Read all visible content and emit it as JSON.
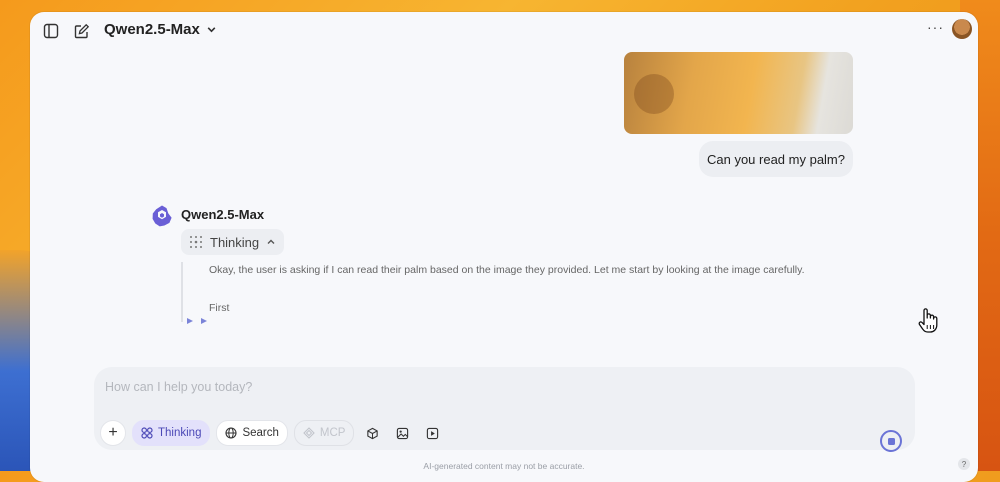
{
  "header": {
    "model_name": "Qwen2.5-Max",
    "more_label": "···"
  },
  "chat": {
    "user_message": "Can you read my palm?",
    "assistant_name": "Qwen2.5-Max",
    "thinking_label": "Thinking",
    "thinking_text_1": "Okay, the user is asking if I can read their palm based on the image they provided. Let me start by looking at the image carefully.",
    "thinking_text_2": "First"
  },
  "composer": {
    "placeholder": "How can I help you today?",
    "thinking_chip": "Thinking",
    "search_chip": "Search",
    "mcp_chip": "MCP"
  },
  "footer": {
    "disclaimer": "AI-generated content may not be accurate.",
    "help": "?"
  },
  "colors": {
    "accent": "#6b74d6",
    "active_chip_bg": "#e3e1fb"
  }
}
